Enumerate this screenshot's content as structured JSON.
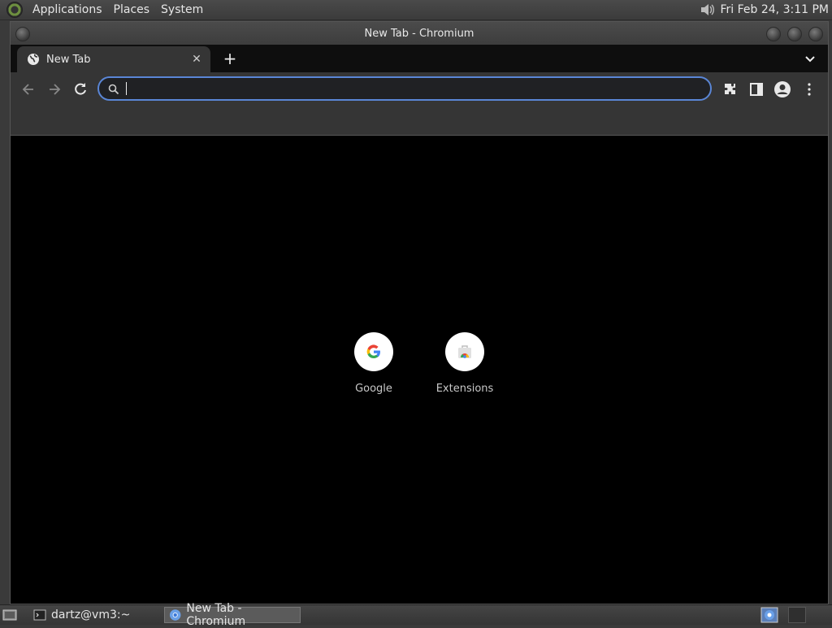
{
  "top_panel": {
    "menus": [
      "Applications",
      "Places",
      "System"
    ],
    "clock": "Fri Feb 24,  3:11 PM",
    "icons": [
      "distro-logo-icon",
      "volume-icon"
    ]
  },
  "window": {
    "title": "New Tab - Chromium"
  },
  "tabs": [
    {
      "label": "New Tab",
      "icon": "globe-icon"
    }
  ],
  "toolbar": {
    "omnibox_value": "",
    "omnibox_placeholder": "",
    "icons": [
      "back-icon",
      "forward-icon",
      "reload-icon",
      "search-icon",
      "extensions-icon",
      "side-panel-icon",
      "profile-icon",
      "menu-icon"
    ]
  },
  "shortcuts": [
    {
      "label": "Google",
      "icon": "google-icon"
    },
    {
      "label": "Extensions",
      "icon": "web-store-icon"
    }
  ],
  "taskbar": {
    "items": [
      {
        "label": "dartz@vm3:~",
        "icon": "terminal-icon"
      },
      {
        "label": "New Tab - Chromium",
        "icon": "chromium-icon"
      }
    ]
  },
  "colors": {
    "accent": "#5a86d6",
    "toolbar": "#353535",
    "content_bg": "#000000"
  }
}
